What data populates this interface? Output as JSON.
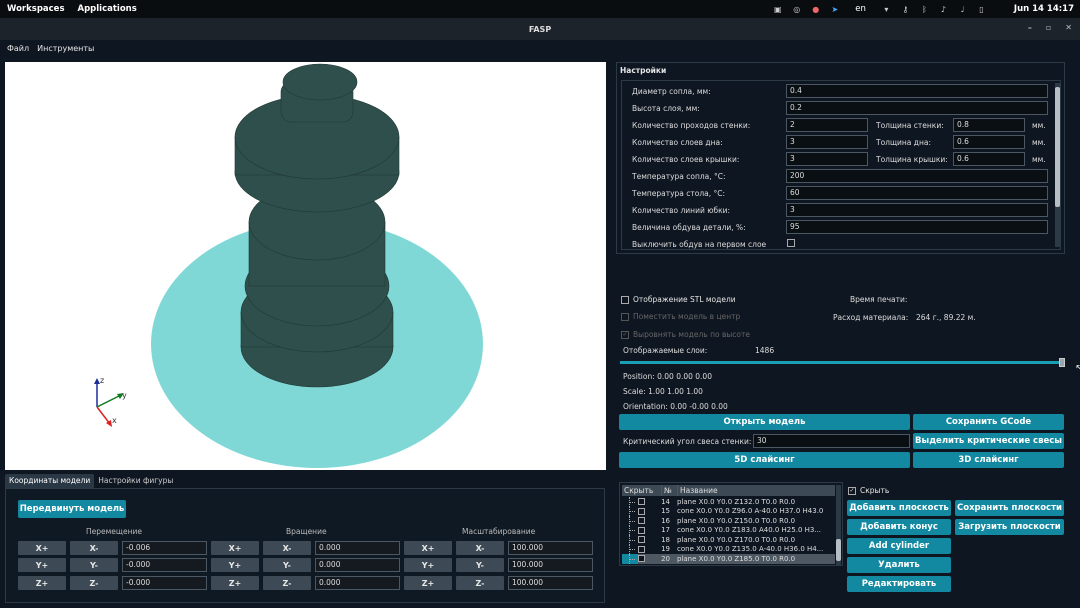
{
  "topbar": {
    "workspaces": "Workspaces",
    "applications": "Applications",
    "lang": "en",
    "datetime": "Jun 14  14:17"
  },
  "window": {
    "title": "FASP",
    "minimize": "–",
    "maximize": "▫",
    "close": "✕"
  },
  "menu": {
    "file": "Файл",
    "tools": "Инструменты"
  },
  "viewport": {
    "axis_x": "x",
    "axis_y": "y",
    "axis_z": "z",
    "bed_color": "#7fd8d6",
    "model_color": "#2f4f4c"
  },
  "bottom_tabs": {
    "coords": "Координаты модели",
    "shape": "Настройки фигуры"
  },
  "coords": {
    "move_model": "Передвинуть модель",
    "translation": "Перемещение",
    "rotation": "Вращение",
    "scale": "Масштабирование",
    "xp": "X+",
    "xm": "X-",
    "yp": "Y+",
    "ym": "Y-",
    "zp": "Z+",
    "zm": "Z-",
    "tx": "-0.006",
    "ty": "-0.000",
    "tz": "-0.000",
    "rx": "0.000",
    "ry": "0.000",
    "rz": "0.000",
    "sx": "100.000",
    "sy": "100.000",
    "sz": "100.000"
  },
  "settings": {
    "header": "Настройки",
    "nozzle_diam_label": "Диаметр сопла, мм:",
    "nozzle_diam": "0.4",
    "layer_h_label": "Высота слоя, мм:",
    "layer_h": "0.2",
    "wall_count_label": "Количество проходов стенки:",
    "wall_count": "2",
    "wall_th_label": "Толщина стенки:",
    "wall_th": "0.8",
    "bottom_layers_label": "Количество слоев дна:",
    "bottom_layers": "3",
    "bottom_th_label": "Толщина дна:",
    "bottom_th": "0.6",
    "top_layers_label": "Количество слоев крышки:",
    "top_layers": "3",
    "top_th_label": "Толщина крышки:",
    "top_th": "0.6",
    "mm": "мм.",
    "nozzle_temp_label": "Температура сопла, °C:",
    "nozzle_temp": "200",
    "bed_temp_label": "Температура стола, °C:",
    "bed_temp": "60",
    "skirt_label": "Количество линий юбки:",
    "skirt": "3",
    "fan_label": "Величина обдува детали, %:",
    "fan": "95",
    "fan_first_label": "Выключить обдув на первом слое"
  },
  "options": {
    "show_stl": "Отображение STL модели",
    "center": "Поместить модель в центр",
    "align": "Выровнять модель по высоте",
    "print_time": "Время печати:",
    "material_label": "Расход материала:",
    "material_value": "264 г., 89.22 м.",
    "layers_label": "Отображаемые слои:",
    "layers_value": "1486",
    "position": "Position: 0.00 0.00 0.00",
    "scale": "Scale: 1.00 1.00 1.00",
    "orientation": "Orientation: 0.00 -0.00 0.00",
    "layer_slider_fraction": 1.0
  },
  "buttons": {
    "open_model": "Открыть модель",
    "save_gcode": "Сохранить GCode",
    "critical_angle_label": "Критический угол свеса стенки:",
    "critical_angle": "30",
    "highlight": "Выделить критические свесы",
    "slice5d": "5D слайсинг",
    "slice3d": "3D слайсинг"
  },
  "planes": {
    "col_hide": "Скрыть",
    "col_num": "№",
    "col_name": "Название",
    "hide_label": "Скрыть",
    "rows": [
      {
        "num": "14",
        "name": "plane X0.0 Y0.0 Z132.0 T0.0 R0.0"
      },
      {
        "num": "15",
        "name": "cone X0.0 Y0.0 Z96.0 A-40.0 H37.0 H43.0"
      },
      {
        "num": "16",
        "name": "plane X0.0 Y0.0 Z150.0 T0.0 R0.0"
      },
      {
        "num": "17",
        "name": "cone X0.0 Y0.0 Z183.0 A40.0 H25.0 H3..."
      },
      {
        "num": "18",
        "name": "plane X0.0 Y0.0 Z170.0 T0.0 R0.0"
      },
      {
        "num": "19",
        "name": "cone X0.0 Y0.0 Z135.0 A-40.0 H36.0 H4..."
      },
      {
        "num": "20",
        "name": "plane X0.0 Y0.0 Z185.0 T0.0 R0.0"
      }
    ],
    "add_plane": "Добавить плоскость",
    "save_planes": "Сохранить плоскости",
    "add_cone": "Добавить конус",
    "load_planes": "Загрузить плоскости",
    "add_cylinder": "Add cylinder",
    "delete": "Удалить",
    "edit": "Редактировать"
  }
}
